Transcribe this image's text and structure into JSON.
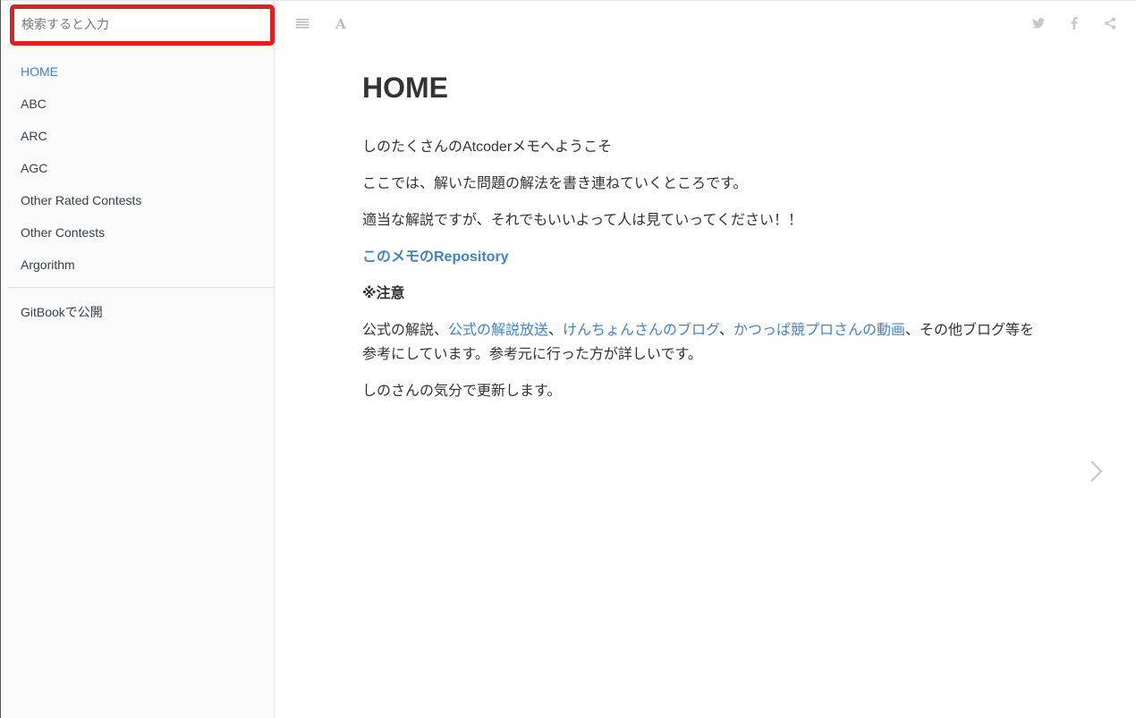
{
  "sidebar": {
    "search": {
      "placeholder": "検索すると入力"
    },
    "items": [
      {
        "label": "HOME",
        "active": true
      },
      {
        "label": "ABC"
      },
      {
        "label": "ARC"
      },
      {
        "label": "AGC"
      },
      {
        "label": "Other Rated Contests"
      },
      {
        "label": "Other Contests"
      },
      {
        "label": "Argorithm"
      }
    ],
    "publish_link": "GitBookで公開"
  },
  "toolbar": {
    "left_icons": [
      "menu-icon",
      "font-settings-icon"
    ],
    "right_icons": [
      "twitter-icon",
      "facebook-icon",
      "share-icon"
    ]
  },
  "main": {
    "title": "HOME",
    "p1": "しのたくさんのAtcoderメモへようこそ",
    "p2": "ここでは、解いた問題の解法を書き連ねていくところです。",
    "p3": "適当な解説ですが、それでもいいよって人は見ていってください！！",
    "repo_link": "このメモのRepository",
    "note_heading": "※注意",
    "refs": {
      "prefix": "公式の解説、",
      "link1": "公式の解説放送",
      "sep1": "、",
      "link2": "けんちょんさんのブログ",
      "sep2": "、",
      "link3": "かつっぱ競プロさんの動画",
      "suffix_line1": "、その他ブログ等を",
      "line2": "参考にしています。参考元に行った方が詳しいです。"
    },
    "p_last": "しのさんの気分で更新します。"
  },
  "colors": {
    "accent": "#4183c4",
    "highlight_border": "#e02020",
    "sidebar_bg": "#fafafa",
    "icon_gray": "#cccccc"
  },
  "icons": {
    "next": "chevron-right-icon"
  }
}
